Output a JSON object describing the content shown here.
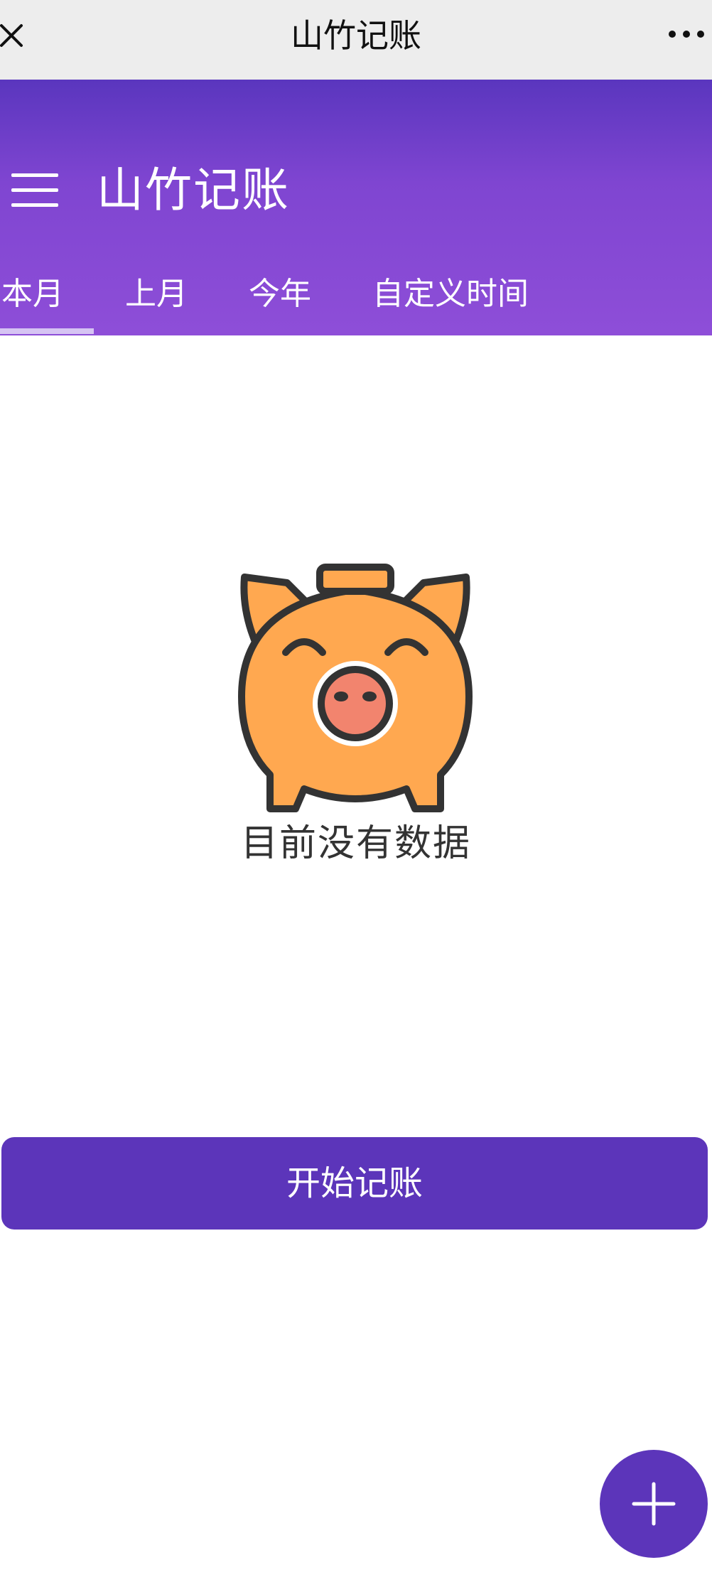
{
  "topbar": {
    "title": "山竹记账",
    "close_icon": "close-icon",
    "more_icon": "more-dots-icon"
  },
  "header": {
    "menu_icon": "hamburger-menu-icon",
    "title": "山竹记账",
    "tabs": [
      {
        "label": "本月",
        "active": true
      },
      {
        "label": "上月",
        "active": false
      },
      {
        "label": "今年",
        "active": false
      },
      {
        "label": "自定义时间",
        "active": false
      }
    ]
  },
  "empty_state": {
    "illustration": "piggy-bank-icon",
    "message": "目前没有数据"
  },
  "actions": {
    "start_label": "开始记账",
    "fab_icon": "plus-icon"
  },
  "colors": {
    "primary": "#5c35ba",
    "header_gradient_top": "#5a36be",
    "header_gradient_bottom": "#8e4ed8",
    "pig_body": "#ffa850",
    "pig_nose": "#f2846e"
  }
}
